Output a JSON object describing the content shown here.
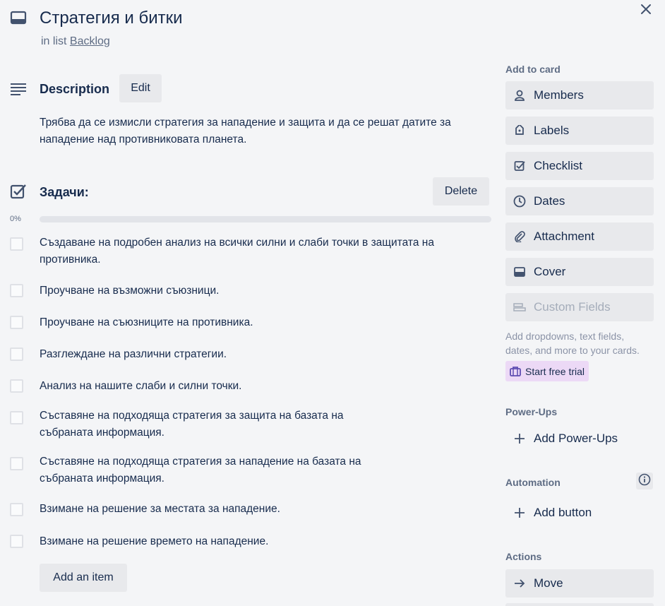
{
  "card": {
    "title": "Стратегия и битки",
    "in_list_prefix": "in list",
    "list_name": "Backlog"
  },
  "description": {
    "heading": "Description",
    "edit_label": "Edit",
    "text": "Трябва да се измисли стратегия за нападение и защита и да се решат датите за нападение над противниковата планета."
  },
  "checklist": {
    "heading": "Задачи:",
    "delete_label": "Delete",
    "progress_text": "0%",
    "progress_fraction": 0,
    "progress_color": "#5aac44",
    "items": [
      {
        "text": "Създаване на подробен анализ на всички силни и слаби точки в защитата на противника.",
        "checked": false
      },
      {
        "text": "Проучване на възможни съюзници.",
        "checked": false
      },
      {
        "text": "Проучване на съюзниците на противника.",
        "checked": false
      },
      {
        "text": "Разглеждане на различни стратегии.",
        "checked": false
      },
      {
        "text": "Анализ на нашите слаби и силни точки.",
        "checked": false
      },
      {
        "text": "Съставяне на подходяща стратегия за защита на базата на събраната информация.",
        "checked": false
      },
      {
        "text": "Съставяне на подходяща стратегия за нападение на базата на събраната информация.",
        "checked": false
      },
      {
        "text": "Взимане на решение за местата за нападение.",
        "checked": false
      },
      {
        "text": "Взимане на решение времето на нападение.",
        "checked": false
      }
    ],
    "add_item_label": "Add an item"
  },
  "sidebar": {
    "add_to_card_heading": "Add to card",
    "buttons": [
      {
        "label": "Members",
        "icon": "person-icon"
      },
      {
        "label": "Labels",
        "icon": "tag-icon"
      },
      {
        "label": "Checklist",
        "icon": "checkbox-icon"
      },
      {
        "label": "Dates",
        "icon": "clock-icon"
      },
      {
        "label": "Attachment",
        "icon": "paperclip-icon"
      },
      {
        "label": "Cover",
        "icon": "cover-icon"
      },
      {
        "label": "Custom Fields",
        "icon": "custom-fields-icon",
        "disabled": true
      }
    ],
    "custom_fields_hint": "Add dropdowns, text fields, dates, and more to your cards.",
    "start_trial_label": "Start free trial",
    "trial_color": "#ecd9f6",
    "powerups_heading": "Power-Ups",
    "add_powerups_label": "Add Power-Ups",
    "automation_heading": "Automation",
    "add_button_label": "Add button",
    "actions_heading": "Actions",
    "move_label": "Move"
  }
}
